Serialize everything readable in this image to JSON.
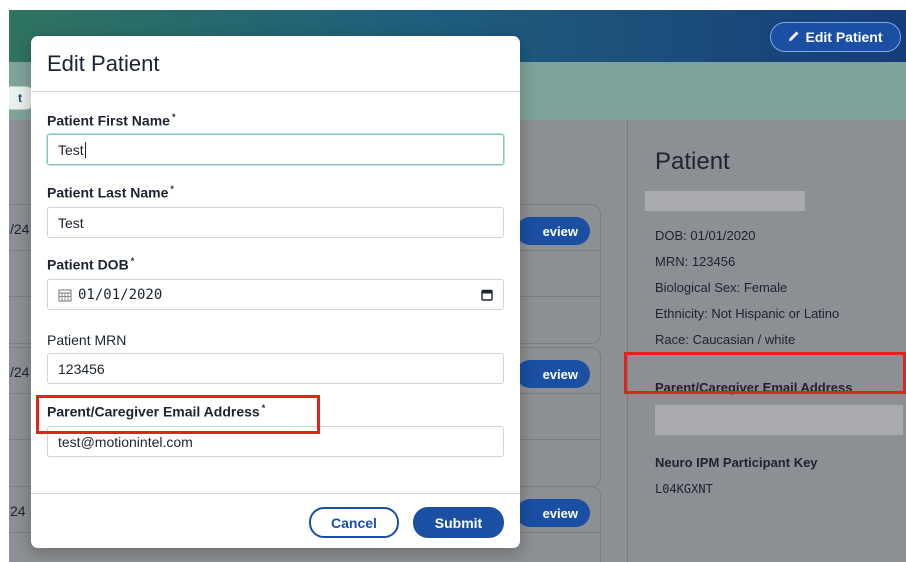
{
  "header": {
    "edit_patient_label": "Edit Patient",
    "left_pill_label": "t"
  },
  "main": {
    "cards": [
      {
        "date": "/24",
        "review_label": "eview"
      },
      {
        "date": "/24",
        "review_label": "eview"
      },
      {
        "date": "24",
        "review_label": "eview"
      }
    ]
  },
  "side_panel": {
    "title": "Patient",
    "dob": "DOB: 01/01/2020",
    "mrn": "MRN: 123456",
    "sex": "Biological Sex: Female",
    "ethnicity": "Ethnicity: Not Hispanic or Latino",
    "race": "Race: Caucasian / white",
    "email_label": "Parent/Caregiver Email Address",
    "key_label": "Neuro IPM Participant Key",
    "key_value": "L04KGXNT"
  },
  "modal": {
    "title": "Edit Patient",
    "first_name": {
      "label": "Patient First Name",
      "required_mark": "*",
      "value": "Test"
    },
    "last_name": {
      "label": "Patient Last Name",
      "required_mark": "*",
      "value": "Test"
    },
    "dob": {
      "label": "Patient DOB",
      "required_mark": "*",
      "value": "01/01/2020"
    },
    "mrn": {
      "label": "Patient MRN",
      "value": "123456"
    },
    "email": {
      "label": "Parent/Caregiver Email Address",
      "required_mark": "*",
      "value": "test@motionintel.com"
    },
    "cancel_label": "Cancel",
    "submit_label": "Submit"
  },
  "colors": {
    "primary": "#1a4fa3",
    "highlight": "#e0241b",
    "overlay": "#8c8f93"
  },
  "icons": [
    "pencil-icon",
    "calendar-icon"
  ]
}
